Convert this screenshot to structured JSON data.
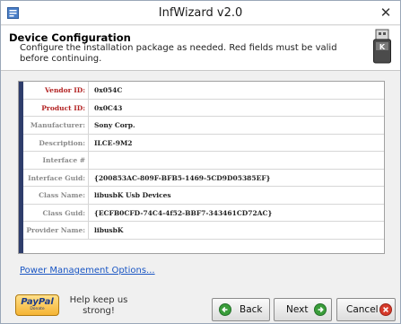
{
  "window": {
    "title": "InfWizard v2.0"
  },
  "header": {
    "title": "Device Configuration",
    "description": "Configure the installation package as needed. Red fields must be valid before continuing."
  },
  "properties": [
    {
      "label": "Vendor ID:",
      "value": "0x054C",
      "required": true
    },
    {
      "label": "Product ID:",
      "value": "0x0C43",
      "required": true
    },
    {
      "label": "Manufacturer:",
      "value": "Sony Corp.",
      "required": false
    },
    {
      "label": "Description:",
      "value": "ILCE-9M2",
      "required": false
    },
    {
      "label": "Interface #",
      "value": "",
      "required": false
    },
    {
      "label": "Interface Guid:",
      "value": "{200853AC-809F-BFB5-1469-5CD9D05385EF}",
      "required": false
    },
    {
      "label": "Class Name:",
      "value": "libusbK Usb Devices",
      "required": false
    },
    {
      "label": "Class Guid:",
      "value": "{ECFB0CFD-74C4-4f52-BBF7-343461CD72AC}",
      "required": false
    },
    {
      "label": "Provider Name:",
      "value": "libusbK",
      "required": false
    }
  ],
  "links": {
    "power_management": "Power Management Options..."
  },
  "footer": {
    "paypal_label": "PayPal",
    "paypal_sub": "Donate",
    "help_text": "Help keep us strong!",
    "back_label": "Back",
    "next_label": "Next",
    "cancel_label": "Cancel"
  },
  "colors": {
    "required_label": "#b22222",
    "optional_label": "#8a8a8a",
    "link": "#1a56c4",
    "grid_strip": "#2e3d6b",
    "back_icon": "#3a9d3a",
    "next_icon": "#3a9d3a",
    "cancel_icon": "#d63a2a"
  },
  "icons": {
    "app": "window-icon",
    "header": "usb-key-icon",
    "back": "arrow-left-icon",
    "next": "arrow-right-icon",
    "cancel": "close-circle-icon"
  }
}
